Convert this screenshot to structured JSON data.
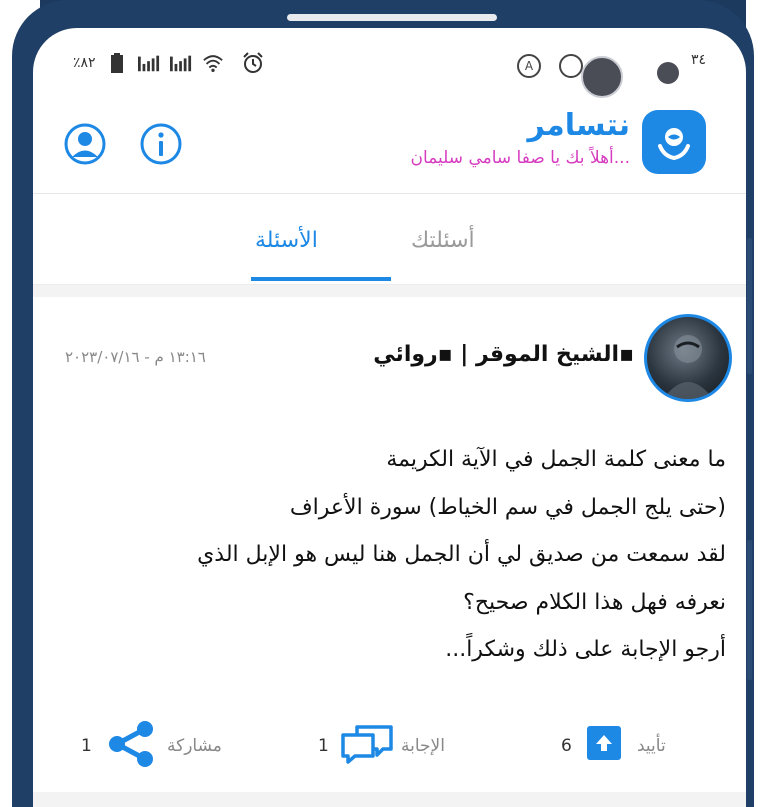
{
  "status_bar": {
    "battery_text": "٪٨٢",
    "clock_text": "٣٤",
    "icons": [
      "battery-icon",
      "signal-icon",
      "signal-icon",
      "wifi-icon",
      "alarm-icon",
      "a-icon",
      "data-saver-icon"
    ]
  },
  "app": {
    "title": "نتسامر",
    "subtitle": "أهلاً بك يا صفا سامي سليمان...",
    "logo_icon": "brain-hands-icon",
    "user_icon": "user-icon",
    "info_icon": "info-icon",
    "accent_color": "#1e88e5",
    "subtitle_color": "#d63cc0"
  },
  "tabs": [
    {
      "label": "الأسئلة",
      "active": true
    },
    {
      "label": "أسئلتك",
      "active": false
    }
  ],
  "post": {
    "author": "الشيخ الموقر | ▪روائي▪",
    "timestamp": "١٣:١٦ م - ٢٠٢٣/٠٧/١٦",
    "lines": [
      "ما معنى كلمة الجمل في الآية الكريمة",
      "(حتى يلج الجمل في سم الخياط) سورة الأعراف",
      "لقد سمعت من صديق لي أن الجمل هنا ليس هو الإبل الذي",
      "نعرفه فهل هذا الكلام صحيح؟",
      "أرجو الإجابة على ذلك وشكراً..."
    ],
    "actions": {
      "upvote_label": "تأييد",
      "upvote_count": "6",
      "answer_label": "الإجابة",
      "answer_count": "1",
      "share_label": "مشاركة",
      "share_count": "1"
    }
  }
}
